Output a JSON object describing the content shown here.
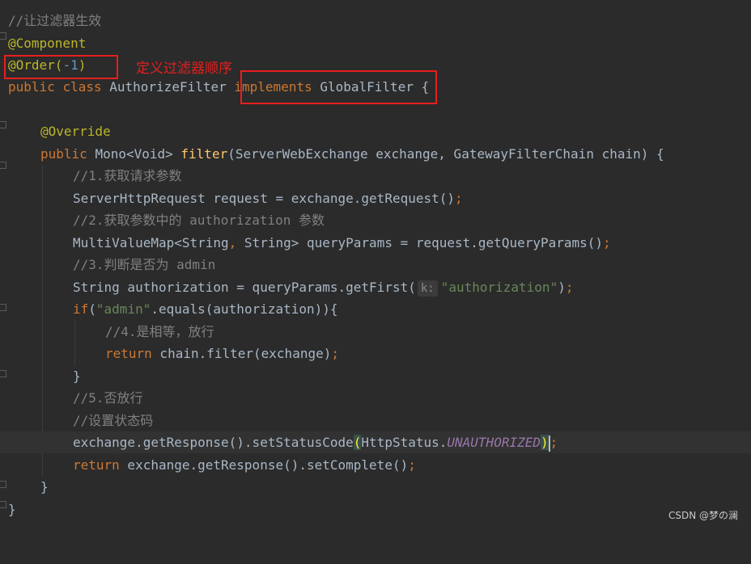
{
  "code": {
    "l1_comment": "//让过滤器生效",
    "l2_annotation": "@Component",
    "l3_annotation": "@Order(",
    "l3_num": "-1",
    "l3_close": ")",
    "l4_public": "public",
    "l4_class": "class",
    "l4_name": "AuthorizeFilter",
    "l4_implements": "implements",
    "l4_iface": "GlobalFilter",
    "l4_brace": "{",
    "l6_override": "@Override",
    "l7_public": "public",
    "l7_type": "Mono<Void>",
    "l7_method": "filter",
    "l7_params": "(ServerWebExchange exchange, GatewayFilterChain chain) {",
    "l8_comment": "//1.获取请求参数",
    "l9_code": "ServerHttpRequest request = exchange.getRequest()",
    "l9_semi": ";",
    "l10_comment": "//2.获取参数中的 authorization 参数",
    "l11_a": "MultiValueMap<String",
    "l11_comma": ",",
    "l11_b": " String> queryParams = request.getQueryParams()",
    "l11_semi": ";",
    "l12_comment": "//3.判断是否为 admin",
    "l13_code": "String authorization = queryParams.getFirst(",
    "l13_hint": "k:",
    "l13_str": "\"authorization\"",
    "l13_close": ")",
    "l13_semi": ";",
    "l14_if": "if",
    "l14_open": "(",
    "l14_str": "\"admin\"",
    "l14_rest": ".equals(authorization)){",
    "l15_comment": "//4.是相等，放行",
    "l16_return": "return",
    "l16_code": " chain.filter(exchange)",
    "l16_semi": ";",
    "l17_brace": "}",
    "l18_comment": "//5.否放行",
    "l19_comment": "//设置状态码",
    "l20_code": "exchange.getResponse().setStatusCode",
    "l20_open": "(",
    "l20_cls": "HttpStatus.",
    "l20_const": "UNAUTHORIZED",
    "l20_close": ")",
    "l20_semi": ";",
    "l21_return": "return",
    "l21_code": " exchange.getResponse().setComplete()",
    "l21_semi": ";",
    "l22_brace": "}",
    "l23_brace": "}"
  },
  "annotation_callout": "定义过滤器顺序",
  "watermark": "CSDN @梦の澜",
  "colors": {
    "background": "#2b2b2b",
    "comment": "#808080",
    "annotation": "#bbb529",
    "keyword": "#cc7832",
    "string": "#6a8759",
    "number": "#6897bb",
    "method": "#ffc66d",
    "constant": "#9876aa",
    "highlight_box": "#e81e1e"
  }
}
